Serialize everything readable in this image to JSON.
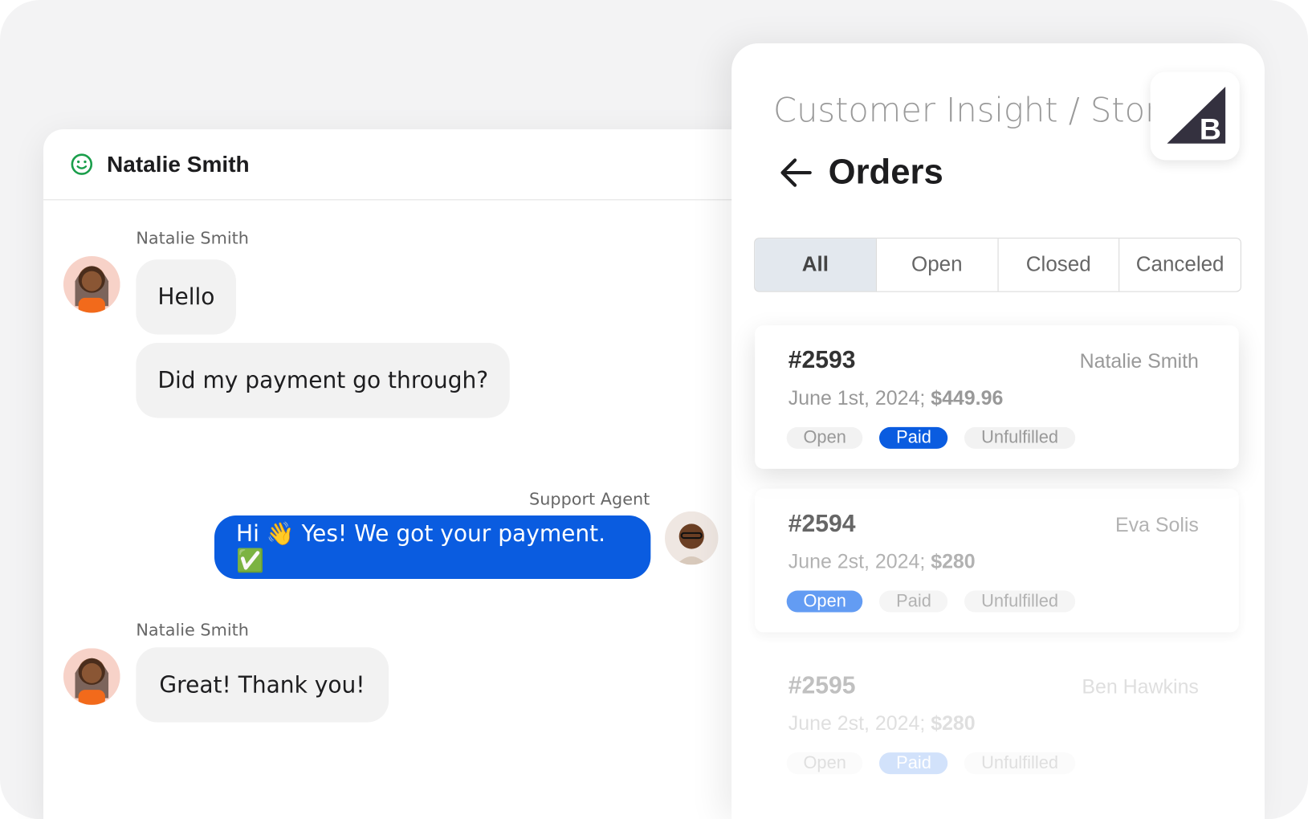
{
  "chat": {
    "contact_name": "Natalie Smith",
    "messages": [
      {
        "sender": "Natalie Smith",
        "bubbles": [
          "Hello",
          "Did my payment go through?"
        ]
      },
      {
        "sender": "Support Agent",
        "bubbles": [
          "Hi 👋 Yes! We got your payment. ✅"
        ]
      },
      {
        "sender": "Natalie Smith",
        "bubbles": [
          "Great! Thank you!"
        ]
      }
    ]
  },
  "panel": {
    "breadcrumb": "Customer Insight / Store",
    "title": "Orders",
    "logo": "B",
    "tabs": [
      "All",
      "Open",
      "Closed",
      "Canceled"
    ],
    "active_tab": "All",
    "orders": [
      {
        "number": "#2593",
        "customer": "Natalie Smith",
        "date": "June 1st, 2024;",
        "amount": "$449.96",
        "tags": [
          "Open",
          "Paid",
          "Unfulfilled"
        ],
        "active_tag": "Paid"
      },
      {
        "number": "#2594",
        "customer": "Eva Solis",
        "date": "June 2st, 2024;",
        "amount": "$280",
        "tags": [
          "Open",
          "Paid",
          "Unfulfilled"
        ],
        "active_tag": "Open"
      },
      {
        "number": "#2595",
        "customer": "Ben Hawkins",
        "date": "June 2st, 2024;",
        "amount": "$280",
        "tags": [
          "Open",
          "Paid",
          "Unfulfilled"
        ],
        "active_tag": "Paid"
      }
    ]
  },
  "colors": {
    "accent": "#0a5ce0",
    "online": "#1a9e4b"
  }
}
